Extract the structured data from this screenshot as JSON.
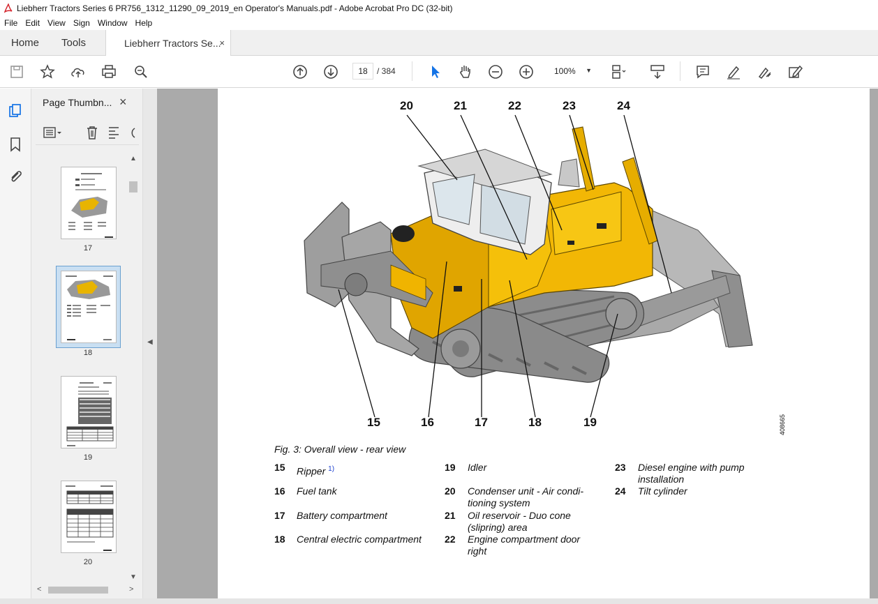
{
  "window": {
    "title": "Liebherr Tractors Series 6 PR756_1312_11290_09_2019_en Operator's Manuals.pdf - Adobe Acrobat Pro DC (32-bit)"
  },
  "menu": [
    "File",
    "Edit",
    "View",
    "Sign",
    "Window",
    "Help"
  ],
  "tabs": {
    "home": "Home",
    "tools": "Tools",
    "doc": "Liebherr Tractors Se...",
    "close": "×"
  },
  "toolbar": {
    "page_current": "18",
    "page_total": "/  384",
    "zoom": "100%"
  },
  "thumbnails": {
    "title": "Page Thumbn...",
    "close": "×",
    "pages": [
      "17",
      "18",
      "19",
      "20"
    ],
    "selected": "18"
  },
  "figure": {
    "callouts_top": [
      "20",
      "21",
      "22",
      "23",
      "24"
    ],
    "callouts_bottom": [
      "15",
      "16",
      "17",
      "18",
      "19"
    ],
    "code": "408665",
    "caption": "Fig. 3: Overall view - rear view"
  },
  "legend": [
    {
      "num": "15",
      "text": "Ripper",
      "sup": "1)"
    },
    {
      "num": "16",
      "text": "Fuel tank"
    },
    {
      "num": "17",
      "text": "Battery compartment"
    },
    {
      "num": "18",
      "text": "Central electric compartment"
    },
    {
      "num": "19",
      "text": "Idler"
    },
    {
      "num": "20",
      "text": "Condenser unit - Air condi-\ntioning system"
    },
    {
      "num": "21",
      "text": "Oil reservoir - Duo cone\n(slipring) area"
    },
    {
      "num": "22",
      "text": "Engine compartment door\nright"
    },
    {
      "num": "23",
      "text": "Diesel engine with pump\ninstallation"
    },
    {
      "num": "24",
      "text": "Tilt cylinder"
    }
  ]
}
